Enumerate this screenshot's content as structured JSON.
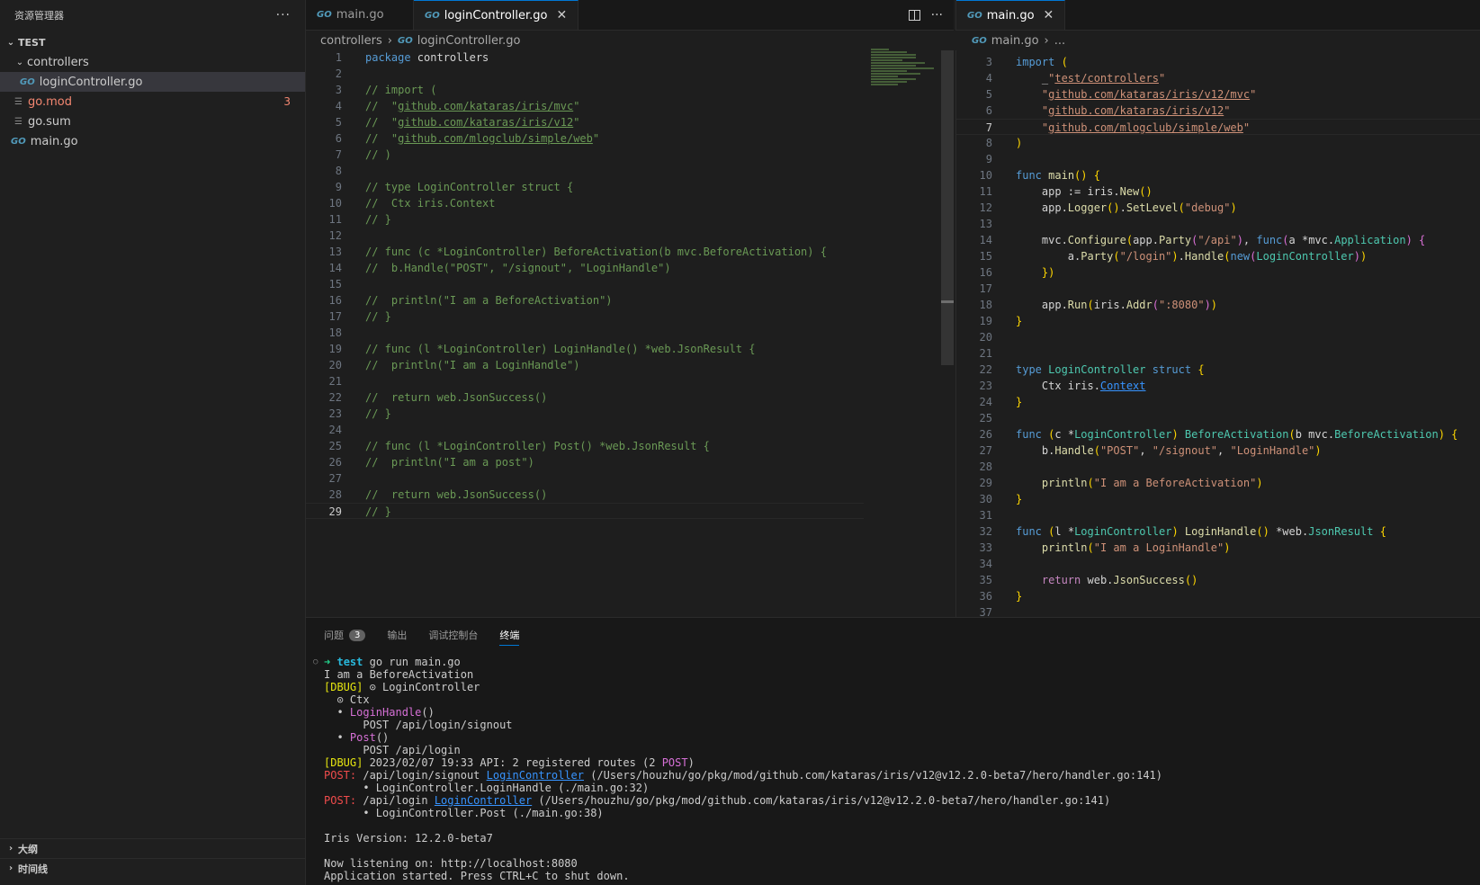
{
  "sidebar": {
    "title": "资源管理器",
    "more": "···",
    "root": "TEST",
    "tree": [
      {
        "label": "controllers",
        "kind": "folder",
        "icon": "chevron-down-icon"
      },
      {
        "label": "loginController.go",
        "kind": "go-file",
        "icon": "go-file-icon"
      },
      {
        "label": "go.mod",
        "kind": "mod-file",
        "icon": "lines-icon",
        "badge": "3"
      },
      {
        "label": "go.sum",
        "kind": "sum-file",
        "icon": "lines-icon"
      },
      {
        "label": "main.go",
        "kind": "go-file",
        "icon": "go-file-icon"
      }
    ],
    "outline": "大纲",
    "timeline": "时间线"
  },
  "editor_left": {
    "tabs": [
      {
        "label": "main.go",
        "active": false
      },
      {
        "label": "loginController.go",
        "active": true
      }
    ],
    "breadcrumb": [
      "controllers",
      "loginController.go"
    ],
    "current_line": 29,
    "lines": [
      "package controllers",
      "",
      "// import (",
      "//  \"github.com/kataras/iris/mvc\"",
      "//  \"github.com/kataras/iris/v12\"",
      "//  \"github.com/mlogclub/simple/web\"",
      "// )",
      "",
      "// type LoginController struct {",
      "//  Ctx iris.Context",
      "// }",
      "",
      "// func (c *LoginController) BeforeActivation(b mvc.BeforeActivation) {",
      "//  b.Handle(\"POST\", \"/signout\", \"LoginHandle\")",
      "",
      "//  println(\"I am a BeforeActivation\")",
      "// }",
      "",
      "// func (l *LoginController) LoginHandle() *web.JsonResult {",
      "//  println(\"I am a LoginHandle\")",
      "",
      "//  return web.JsonSuccess()",
      "// }",
      "",
      "// func (l *LoginController) Post() *web.JsonResult {",
      "//  println(\"I am a post\")",
      "",
      "//  return web.JsonSuccess()",
      "// }"
    ]
  },
  "editor_right": {
    "tabs": [
      {
        "label": "main.go",
        "active": true
      }
    ],
    "breadcrumb": [
      "main.go",
      "..."
    ],
    "first_line": 3,
    "current_line": 7,
    "lines": [
      "import (",
      "    _\"test/controllers\"",
      "    \"github.com/kataras/iris/v12/mvc\"",
      "    \"github.com/kataras/iris/v12\"",
      "    \"github.com/mlogclub/simple/web\"",
      ")",
      "",
      "func main() {",
      "    app := iris.New()",
      "    app.Logger().SetLevel(\"debug\")",
      "",
      "    mvc.Configure(app.Party(\"/api\"), func(a *mvc.Application) {",
      "        a.Party(\"/login\").Handle(new(LoginController))",
      "    })",
      "",
      "    app.Run(iris.Addr(\":8080\"))",
      "}",
      "",
      "",
      "type LoginController struct {",
      "    Ctx iris.Context",
      "}",
      "",
      "func (c *LoginController) BeforeActivation(b mvc.BeforeActivation) {",
      "    b.Handle(\"POST\", \"/signout\", \"LoginHandle\")",
      "",
      "    println(\"I am a BeforeActivation\")",
      "}",
      "",
      "func (l *LoginController) LoginHandle() *web.JsonResult {",
      "    println(\"I am a LoginHandle\")",
      "",
      "    return web.JsonSuccess()",
      "}",
      ""
    ]
  },
  "panel": {
    "tabs": [
      {
        "label": "问题",
        "badge": "3"
      },
      {
        "label": "输出"
      },
      {
        "label": "调试控制台"
      },
      {
        "label": "终端",
        "active": true
      }
    ],
    "terminal": {
      "prompt_arrow": "➜",
      "prompt_dir": "test",
      "command": "go run main.go",
      "lines": [
        "I am a BeforeActivation",
        "[DBUG] ⊙ LoginController",
        "  ⊙ Ctx",
        "  • LoginHandle()",
        "      POST /api/login/signout",
        "  • Post()",
        "      POST /api/login",
        "[DBUG] 2023/02/07 19:33 API: 2 registered routes (2 POST)",
        "POST: /api/login/signout LoginController (/Users/houzhu/go/pkg/mod/github.com/kataras/iris/v12@v12.2.0-beta7/hero/handler.go:141)",
        "      • LoginController.LoginHandle (./main.go:32)",
        "POST: /api/login LoginController (/Users/houzhu/go/pkg/mod/github.com/kataras/iris/v12@v12.2.0-beta7/hero/handler.go:141)",
        "      • LoginController.Post (./main.go:38)",
        "",
        "Iris Version: 12.2.0-beta7",
        "",
        "Now listening on: http://localhost:8080",
        "Application started. Press CTRL+C to shut down."
      ]
    }
  },
  "colors": {
    "background": "#1e1e1e",
    "accent": "#0078d4",
    "error": "#f48771",
    "comment": "#6a9955",
    "keyword": "#569cd6"
  }
}
